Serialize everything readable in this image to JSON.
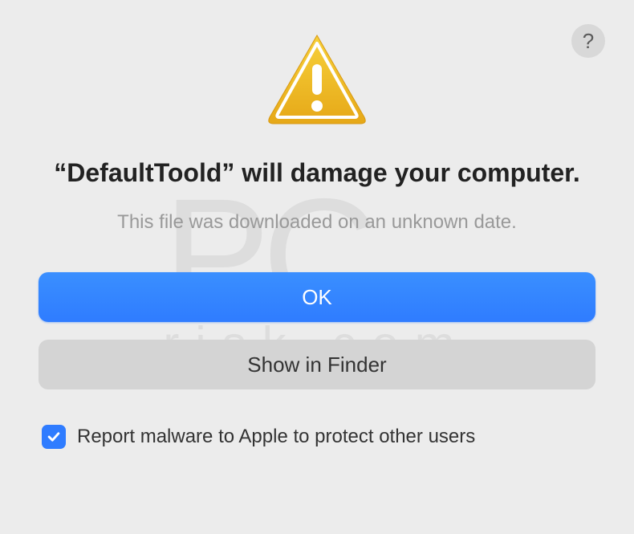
{
  "dialog": {
    "title": "“DefaultToold” will damage your computer.",
    "subtitle": "This file was downloaded on an unknown date.",
    "buttons": {
      "primary": "OK",
      "secondary": "Show in Finder"
    },
    "checkbox": {
      "label": "Report malware to Apple to protect other users",
      "checked": true
    },
    "help_label": "?"
  },
  "colors": {
    "accent": "#2f7cff",
    "background": "#ececec"
  }
}
